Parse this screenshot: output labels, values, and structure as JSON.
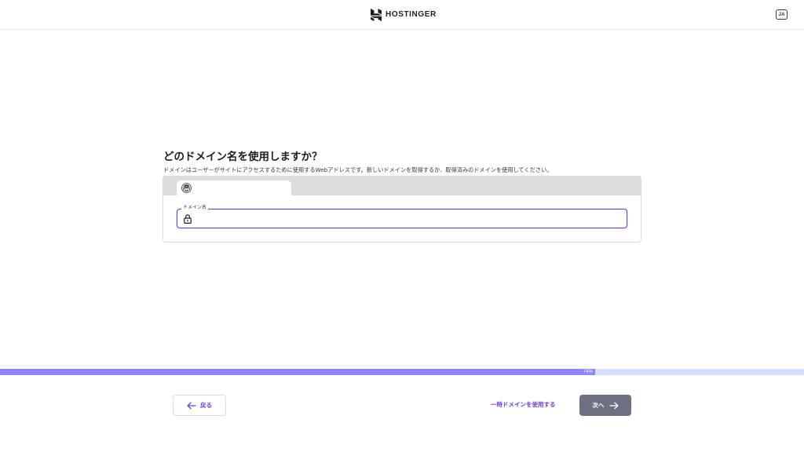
{
  "header": {
    "brand": "HOSTINGER",
    "language": "JA"
  },
  "main": {
    "title": "どのドメイン名を使用しますか？",
    "subtitle": "ドメインはユーザーがサイトにアクセスするために使用するWebアドレスです。新しいドメインを取得するか、取得済みのドメインを使用してください。",
    "domain_field": {
      "label": "ドメイン名",
      "value": "",
      "placeholder": ""
    }
  },
  "progress": {
    "value": 0.74,
    "label": "74%"
  },
  "footer": {
    "back_label": "戻る",
    "temp_domain_label": "一時ドメインを使用する",
    "next_label": "次へ"
  },
  "colors": {
    "accent": "#673de6",
    "progress_fill": "#8c85ff",
    "progress_track": "#d5dfff",
    "next_button_bg": "#6d7081",
    "browser_bar": "#dadce0"
  },
  "icons": {
    "brand": "hostinger-logo-icon",
    "tab": "wordpress-icon",
    "field": "lock-icon",
    "back": "arrow-left-icon",
    "next": "arrow-right-icon"
  }
}
